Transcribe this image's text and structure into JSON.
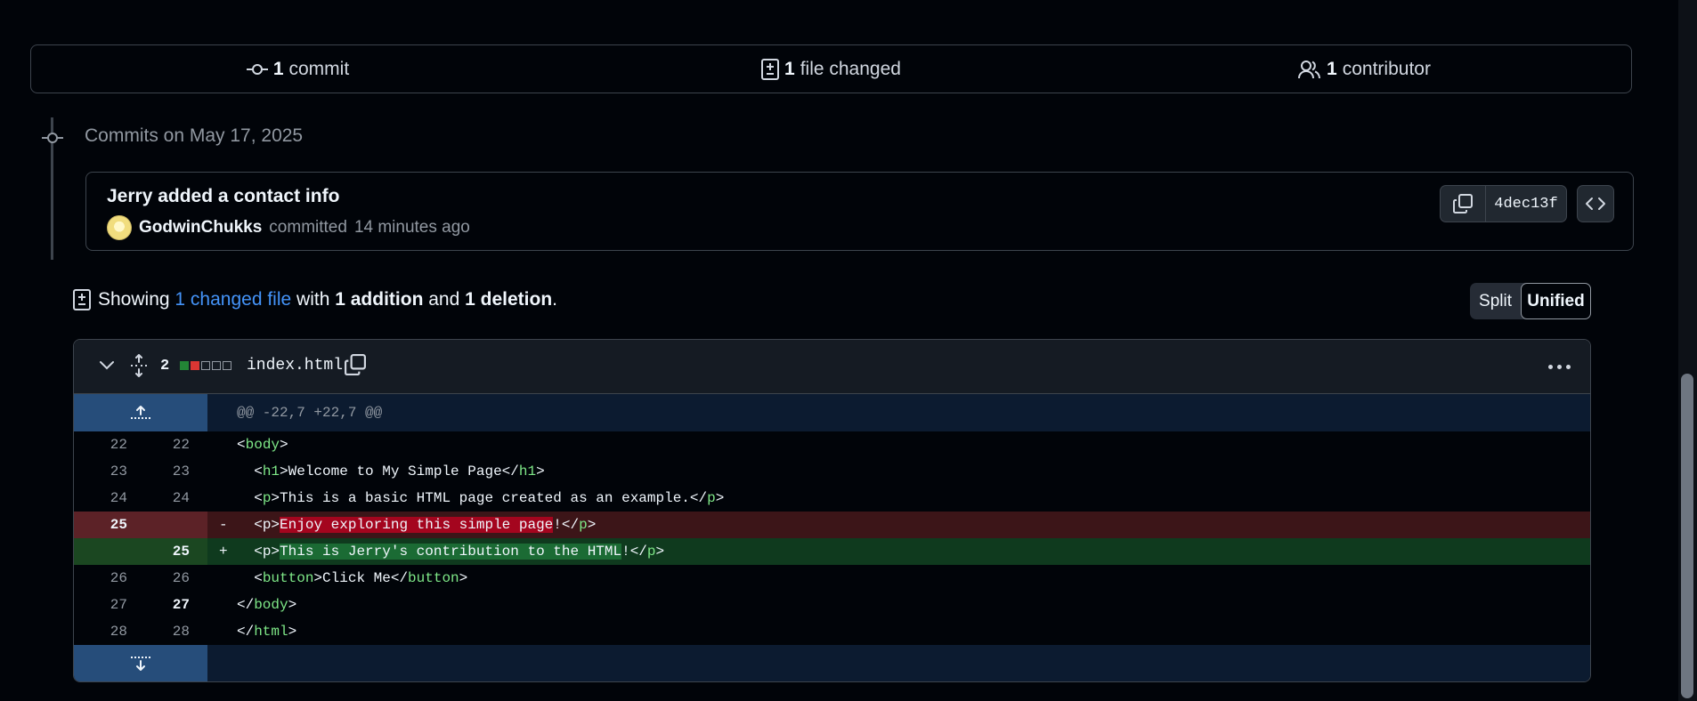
{
  "summary": {
    "commits_count": "1",
    "commits_label": "commit",
    "files_count": "1",
    "files_label": "file changed",
    "contributors_count": "1",
    "contributors_label": "contributor"
  },
  "timeline": {
    "date_label": "Commits on May 17, 2025"
  },
  "commit": {
    "title": "Jerry added a contact info",
    "author": "GodwinChukks",
    "action": "committed",
    "time": "14 minutes ago",
    "sha": "4dec13f"
  },
  "showing": {
    "prefix": "Showing",
    "files_link": "1 changed file",
    "with": "with",
    "additions": "1 addition",
    "and": "and",
    "deletions": "1 deletion",
    "period": "."
  },
  "view_toggle": {
    "split": "Split",
    "unified": "Unified",
    "selected": "Unified"
  },
  "file": {
    "change_count": "2",
    "name": "index.html",
    "hunk_header": "@@ -22,7 +22,7 @@"
  },
  "diff_lines": [
    {
      "old": "22",
      "new": "22",
      "type": "context"
    },
    {
      "old": "23",
      "new": "23",
      "type": "context"
    },
    {
      "old": "24",
      "new": "24",
      "type": "context"
    },
    {
      "old": "25",
      "new": "",
      "type": "deletion",
      "sign": "-"
    },
    {
      "old": "",
      "new": "25",
      "type": "addition",
      "sign": "+"
    },
    {
      "old": "26",
      "new": "26",
      "type": "context"
    },
    {
      "old": "27",
      "new": "27",
      "type": "context"
    },
    {
      "old": "28",
      "new": "28",
      "type": "context"
    }
  ],
  "code": {
    "l22_tag": "body",
    "l23_tag": "h1",
    "l23_text": "Welcome to My Simple Page",
    "l24_tag": "p",
    "l24_text": "This is a basic HTML page created as an example.",
    "l25d_tag": "p",
    "l25d_hl": "Enjoy exploring this simple page",
    "l25d_rest": "!",
    "l25a_tag": "p",
    "l25a_hl": "This is Jerry's contribution to the HTML",
    "l25a_rest": "!",
    "l26_tag": "button",
    "l26_text": "Click Me",
    "l27_tag": "body",
    "l28_tag": "html"
  },
  "colors": {
    "background": "#010409",
    "addition": "#0f3a1e",
    "deletion": "#3c1518",
    "link": "#4493f8",
    "tag": "#7ee787"
  }
}
